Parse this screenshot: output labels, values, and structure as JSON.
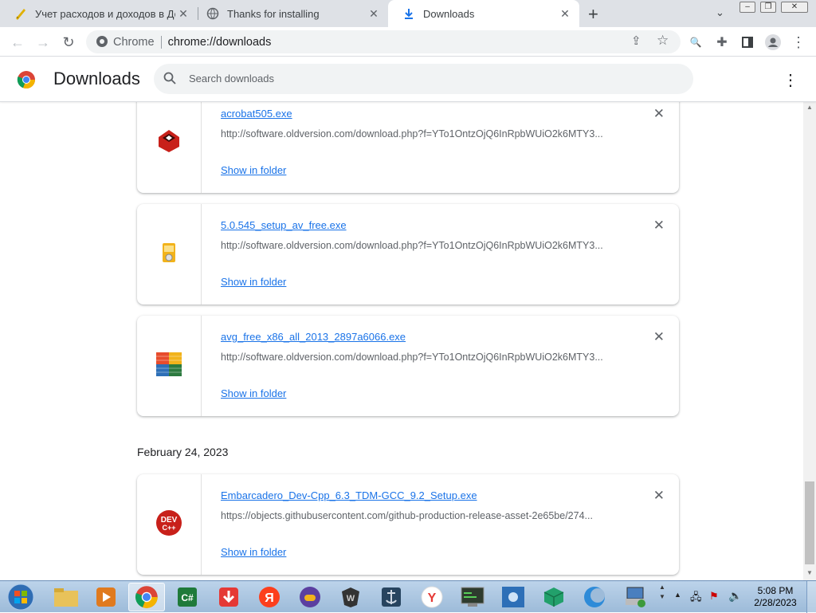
{
  "tabs": [
    {
      "title": "Учет расходов и доходов в Дома",
      "icon": "ruler-icon"
    },
    {
      "title": "Thanks for installing",
      "icon": "globe-icon"
    },
    {
      "title": "Downloads",
      "icon": "download-icon"
    }
  ],
  "omnibox": {
    "chip": "Chrome",
    "url": "chrome://downloads"
  },
  "header": {
    "title": "Downloads",
    "search_placeholder": "Search downloads"
  },
  "downloads": [
    {
      "filename": "acrobat505.exe",
      "url": "http://software.oldversion.com/download.php?f=YTo1OntzOjQ6InRpbWUiO2k6MTY3...",
      "action": "Show in folder",
      "icon": "acrobat-installer-icon"
    },
    {
      "filename": "5.0.545_setup_av_free.exe",
      "url": "http://software.oldversion.com/download.php?f=YTo1OntzOjQ6InRpbWUiO2k6MTY3...",
      "action": "Show in folder",
      "icon": "installer-icon"
    },
    {
      "filename": "avg_free_x86_all_2013_2897a6066.exe",
      "url": "http://software.oldversion.com/download.php?f=YTo1OntzOjQ6InRpbWUiO2k6MTY3...",
      "action": "Show in folder",
      "icon": "avg-icon"
    }
  ],
  "date_group": "February 24, 2023",
  "downloads_2": [
    {
      "filename": "Embarcadero_Dev-Cpp_6.3_TDM-GCC_9.2_Setup.exe",
      "url": "https://objects.githubusercontent.com/github-production-release-asset-2e65be/274...",
      "action": "Show in folder",
      "icon": "dev-cpp-icon"
    }
  ],
  "clock": {
    "time": "5:08 PM",
    "date": "2/28/2023"
  },
  "colors": {
    "link": "#1a73e8",
    "tabstrip": "#dee1e6"
  }
}
